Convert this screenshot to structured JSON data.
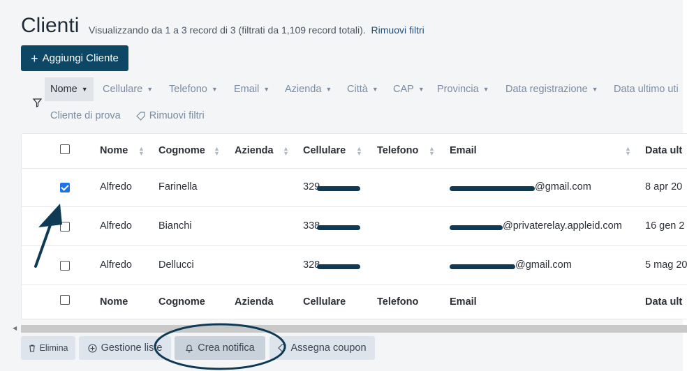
{
  "page": {
    "title": "Clienti",
    "subtitle": "Visualizzando da 1 a 3 record di 3 (filtrati da 1,109 record totali).",
    "subtitle_link": "Rimuovi filtri"
  },
  "add_button": {
    "label": "Aggiungi Cliente",
    "icon": "plus-icon"
  },
  "filters": {
    "items": [
      {
        "label": "Nome",
        "active": true
      },
      {
        "label": "Cellulare"
      },
      {
        "label": "Telefono"
      },
      {
        "label": "Email"
      },
      {
        "label": "Azienda"
      },
      {
        "label": "Città"
      },
      {
        "label": "CAP"
      },
      {
        "label": "Provincia"
      },
      {
        "label": "Data registrazione"
      },
      {
        "label": "Data ultimo uti"
      }
    ],
    "saved": "Cliente di prova",
    "remove": "Rimuovi filtri"
  },
  "table": {
    "columns": [
      "Nome",
      "Cognome",
      "Azienda",
      "Cellulare",
      "Telefono",
      "Email",
      "Data ult"
    ],
    "rows": [
      {
        "checked": true,
        "nome": "Alfredo",
        "cognome": "Farinella",
        "azienda": "",
        "cellulare": "329",
        "telefono": "",
        "email": "@gmail.com",
        "data": "8 apr 20"
      },
      {
        "checked": false,
        "nome": "Alfredo",
        "cognome": "Bianchi",
        "azienda": "",
        "cellulare": "338",
        "telefono": "",
        "email": "@privaterelay.appleid.com",
        "data": "16 gen 2"
      },
      {
        "checked": false,
        "nome": "Alfredo",
        "cognome": "Dellucci",
        "azienda": "",
        "cellulare": "328",
        "telefono": "",
        "email": "@gmail.com",
        "data": "5 mag 20"
      }
    ],
    "footer_columns": [
      "Nome",
      "Cognome",
      "Azienda",
      "Cellulare",
      "Telefono",
      "Email",
      "Data ult"
    ]
  },
  "bulk_actions": [
    {
      "label": "Elimina",
      "icon": "trash-icon"
    },
    {
      "label": "Gestione liste",
      "icon": "plus-circle-icon"
    },
    {
      "label": "Crea notifica",
      "icon": "bell-icon"
    },
    {
      "label": "Assegna coupon",
      "icon": "tag-icon"
    }
  ],
  "colors": {
    "primary": "#0e4766",
    "link": "#1e4f78",
    "annotation": "#0e3a55",
    "checkbox": "#1a73e8"
  }
}
